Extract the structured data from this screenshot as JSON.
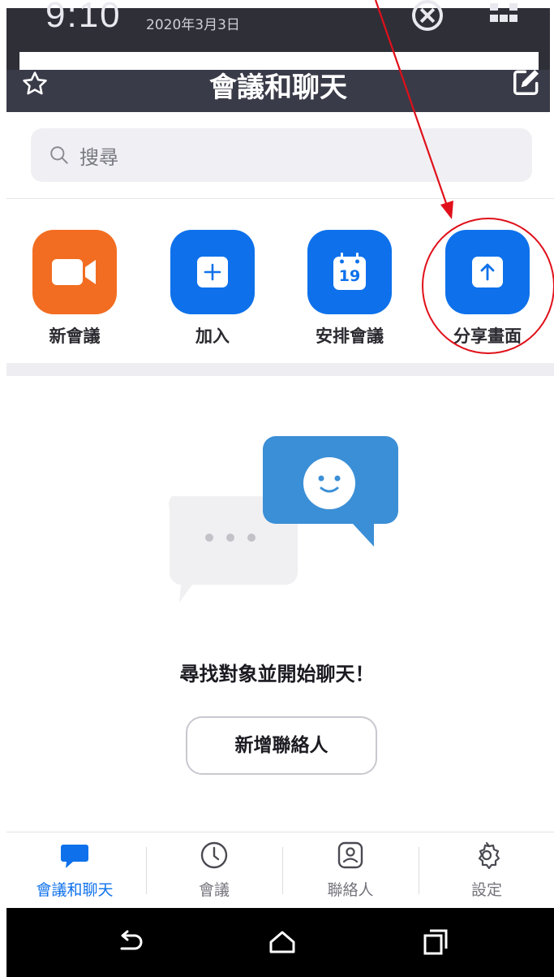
{
  "status_bar": {
    "time": "9:10",
    "date": "2020年3月3日"
  },
  "header": {
    "title": "會議和聊天"
  },
  "search": {
    "placeholder": "搜尋"
  },
  "quick_actions": [
    {
      "label": "新會議"
    },
    {
      "label": "加入"
    },
    {
      "label": "安排會議",
      "calendar_day": "19"
    },
    {
      "label": "分享畫面"
    }
  ],
  "empty_state": {
    "title": "尋找對象並開始聊天！",
    "button_label": "新增聯絡人"
  },
  "tabs": [
    {
      "label": "會議和聊天",
      "active": true
    },
    {
      "label": "會議"
    },
    {
      "label": "聯絡人"
    },
    {
      "label": "設定"
    }
  ],
  "colors": {
    "accent": "#0e71eb",
    "new_meeting": "#f26d21",
    "header_bg": "#3a3b48",
    "annotation": "#e0101a"
  }
}
